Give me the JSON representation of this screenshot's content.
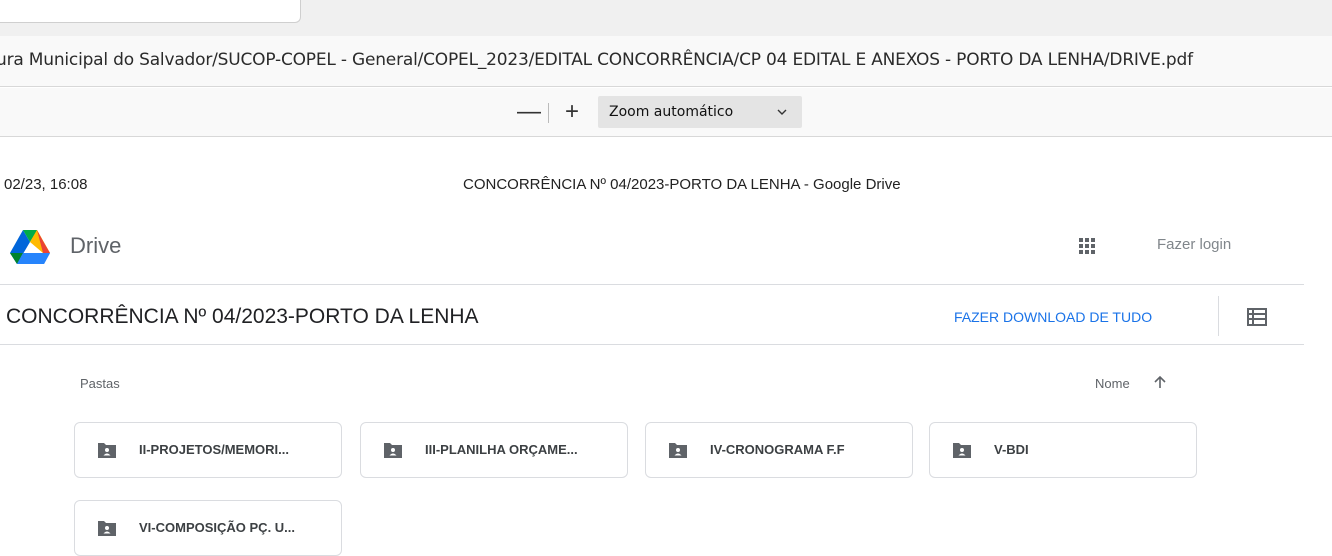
{
  "browser": {
    "path": "ura Municipal do Salvador/SUCOP-COPEL - General/COPEL_2023/EDITAL CONCORRÊNCIA/CP 04 EDITAL E ANEXOS - PORTO DA LENHA/DRIVE.pdf"
  },
  "pdf_toolbar": {
    "zoom_out": "—",
    "zoom_in": "+",
    "zoom_value": "Zoom automático",
    "zoom_icon": "chevron-down-icon"
  },
  "print_header": {
    "date": "02/23, 16:08",
    "title": "CONCORRÊNCIA Nº 04/2023-PORTO DA LENHA - Google Drive"
  },
  "drive": {
    "app_name": "Drive",
    "login": "Fazer login",
    "folder_title": "CONCORRÊNCIA Nº 04/2023-PORTO DA LENHA",
    "download_all": "FAZER DOWNLOAD DE TUDO",
    "section_label": "Pastas",
    "sort_label": "Nome",
    "folders": [
      {
        "name": "II-PROJETOS/MEMORI..."
      },
      {
        "name": "III-PLANILHA ORÇAME..."
      },
      {
        "name": "IV-CRONOGRAMA F.F"
      },
      {
        "name": "V-BDI"
      },
      {
        "name": "VI-COMPOSIÇÃO PÇ. U..."
      }
    ]
  },
  "colors": {
    "accent": "#1a73e8",
    "folder_icon": "#5f6368"
  }
}
